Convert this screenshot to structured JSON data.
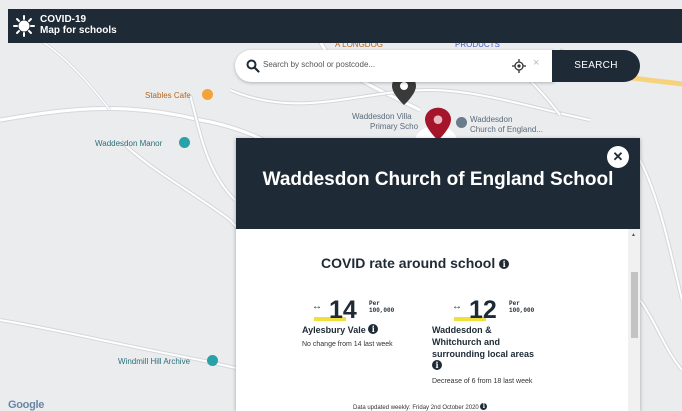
{
  "app": {
    "title_line1": "COVID-19",
    "title_line2": "Map for schools",
    "logo_icon": "virus-icon"
  },
  "search": {
    "placeholder": "Search by school or postcode...",
    "button_label": "SEARCH",
    "clear_glyph": "×",
    "icons": [
      "search-icon",
      "locate-icon",
      "clear-icon"
    ]
  },
  "map": {
    "labels": {
      "stables": "Stables Cafe",
      "manor": "Waddesdon Manor",
      "village_primary_1": "Waddesdon Villa",
      "village_primary_2": "Primary Scho",
      "church_school_1": "Waddesdon",
      "church_school_2": "Church of England...",
      "windmill": "Windmill Hill Archive",
      "top_left_fragment": "A LONGDOG",
      "top_right_fragment": "PRODUCTS"
    },
    "attribution": "Google",
    "colors": {
      "background": "#ebecee",
      "road": "#ffffff",
      "road_outline": "#d5d7db",
      "highway": "#f7d27c",
      "pin_selected": "#a4142b",
      "pin_other": "#3a3a3a"
    }
  },
  "panel": {
    "school_name": "Waddesdon Church of England School",
    "close_glyph": "✕",
    "section_title": "COVID rate around school",
    "info_glyph": "i",
    "stats": [
      {
        "value": "14",
        "per_line1": "Per",
        "per_line2": "100,000",
        "area": "Aylesbury Vale",
        "change": "No change from 14 last week"
      },
      {
        "value": "12",
        "per_line1": "Per",
        "per_line2": "100,000",
        "area": "Waddesdon & Whitchurch and surrounding local areas",
        "change": "Decrease of 6 from 18 last week"
      }
    ],
    "updated": "Data updated weekly: Friday 2nd October 2020",
    "arrow_glyph": "↔",
    "colors": {
      "header": "#1e2a36",
      "highlight": "#f1df3c"
    }
  }
}
